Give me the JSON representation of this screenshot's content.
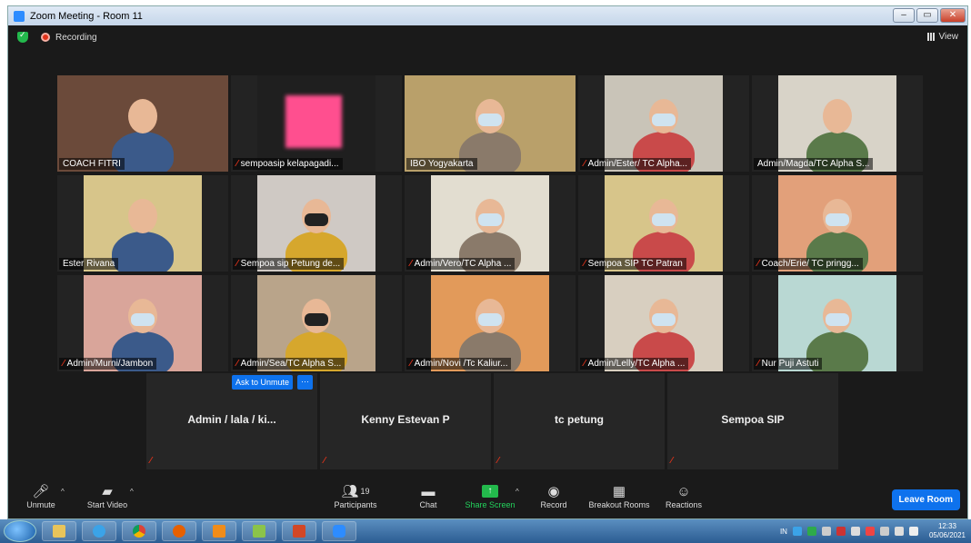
{
  "window": {
    "title": "Zoom Meeting - Room 11",
    "controls": {
      "minimize": "–",
      "restore": "▭",
      "close": "✕"
    }
  },
  "topbar": {
    "recording_label": "Recording",
    "view_label": "View"
  },
  "video_tiles": [
    {
      "name": "COACH FITRI",
      "muted": false,
      "active": true,
      "bg": "#6b4a3a"
    },
    {
      "name": "sempoasip kelapagadi...",
      "muted": true,
      "active": false,
      "bg": "#1f1f1f"
    },
    {
      "name": "IBO Yogyakarta",
      "muted": false,
      "active": false,
      "bg": "#b9a06a"
    },
    {
      "name": "Admin/Ester/ TC Alpha...",
      "muted": true,
      "active": false,
      "bg": "#c9c4b8"
    },
    {
      "name": "Admin/Magda/TC Alpha S...",
      "muted": false,
      "active": false,
      "bg": "#d8d3c8"
    },
    {
      "name": "Ester Rivana",
      "muted": false,
      "active": false,
      "bg": "#d7c58a"
    },
    {
      "name": "Sempoa sip Petung de...",
      "muted": true,
      "active": false,
      "bg": "#cfc9c4"
    },
    {
      "name": "Admin/Vero/TC Alpha ...",
      "muted": true,
      "active": false,
      "bg": "#e2ddd0"
    },
    {
      "name": "Sempoa SIP TC Patran",
      "muted": true,
      "active": false,
      "bg": "#d7c58a"
    },
    {
      "name": "Coach/Erie/ TC pringg...",
      "muted": true,
      "active": false,
      "bg": "#e2a07a"
    },
    {
      "name": "Admin/Murni/Jambon",
      "muted": true,
      "active": false,
      "bg": "#d9a59a"
    },
    {
      "name": "Admin/Sea/TC Alpha S...",
      "muted": true,
      "active": false,
      "bg": "#b9a48a"
    },
    {
      "name": "Admin/Novi /Tc Kaliur...",
      "muted": true,
      "active": false,
      "bg": "#e29a5a"
    },
    {
      "name": "Admin/Lelly/TC Alpha ...",
      "muted": true,
      "active": false,
      "bg": "#d8cfc0"
    },
    {
      "name": "Nur Puji Astuti",
      "muted": true,
      "active": false,
      "bg": "#b9d8d3"
    }
  ],
  "audio_tiles": [
    {
      "name": "Admin / lala / ki..."
    },
    {
      "name": "Kenny Estevan P"
    },
    {
      "name": "tc petung"
    },
    {
      "name": "Sempoa SIP"
    }
  ],
  "ask_to_unmute": "Ask to Unmute",
  "more_label": "···",
  "toolbar": {
    "unmute": "Unmute",
    "start_video": "Start Video",
    "participants": "Participants",
    "participants_count": "19",
    "chat": "Chat",
    "share_screen": "Share Screen",
    "record": "Record",
    "breakout_rooms": "Breakout Rooms",
    "reactions": "Reactions",
    "leave_room": "Leave Room"
  },
  "taskbar": {
    "lang": "IN",
    "time": "12:33",
    "date": "05/06/2021"
  },
  "colors": {
    "accent": "#0e72ed",
    "share_green": "#23b94c",
    "muted_red": "#e0331b",
    "active_border": "#c8e34b"
  }
}
